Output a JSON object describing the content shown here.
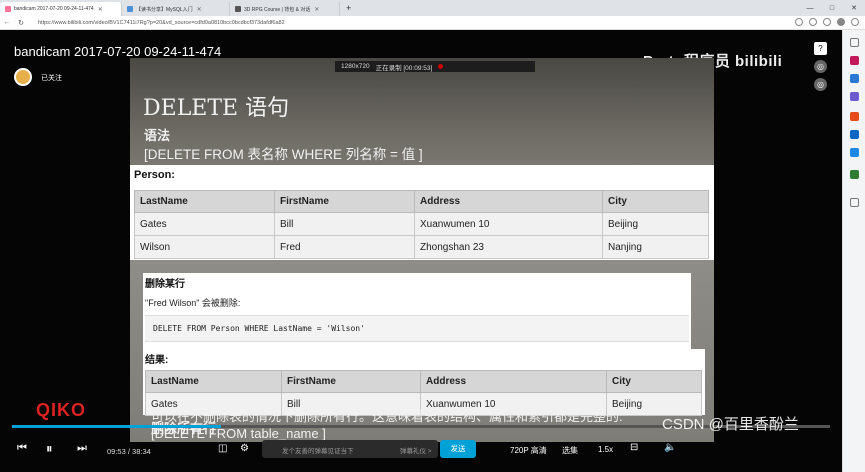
{
  "browser": {
    "tabs": [
      {
        "title": "bandicam 2017-07-20 09-24-11-474",
        "active": true,
        "color": "#fb7299"
      },
      {
        "title": "【读书分享】MySQL入门",
        "active": false,
        "color": "#4a90d9"
      },
      {
        "title": "3D RPG Course | 背包 & 对话",
        "active": false,
        "color": "#555555"
      }
    ],
    "new_tab": "+",
    "url": "https://www.bilibili.com/video/BV1C7411i7Rg?p=20&vd_source=cdfd0a0810bcc0bcdbcf373dafdf6a82",
    "window_controls": [
      "—",
      "□",
      "✕"
    ]
  },
  "video": {
    "title": "bandicam 2017-07-20 09-24-11-474",
    "follow_label": "已关注",
    "brand": "Prato程序员 bilibili",
    "side_controls": [
      "?",
      "◎",
      "◎"
    ],
    "recording_bar": {
      "resolution": "1280x720",
      "status": "正在录制 [00:09:53]"
    }
  },
  "slide": {
    "heading": "DELETE 语句",
    "syntax_label": "语法",
    "syntax": "[DELETE FROM 表名称 WHERE 列名称 = 值 ]",
    "person_label": "Person:",
    "person_table": {
      "headers": [
        "LastName",
        "FirstName",
        "Address",
        "City"
      ],
      "rows": [
        [
          "Gates",
          "Bill",
          "Xuanwumen 10",
          "Beijing"
        ],
        [
          "Wilson",
          "Fred",
          "Zhongshan 23",
          "Nanjing"
        ]
      ]
    },
    "delete_row_label": "删除某行",
    "delete_row_desc": "\"Fred Wilson\" 会被删除:",
    "delete_row_code": "DELETE FROM Person WHERE LastName = 'Wilson'",
    "result_label": "结果:",
    "result_table": {
      "headers": [
        "LastName",
        "FirstName",
        "Address",
        "City"
      ],
      "rows": [
        [
          "Gates",
          "Bill",
          "Xuanwumen 10",
          "Beijing"
        ]
      ]
    },
    "delete_all_label": "删除所有行",
    "delete_all_desc": "可以在不删除表的情况下删除所有行。这意味着表的结构、属性和索引都是完整的:",
    "delete_all_code": "[DELETE FROM table_name ]"
  },
  "player": {
    "current_time": "09:53",
    "total_time": "38:34",
    "progress": 0.256,
    "danmu_placeholder": "发个友善的弹幕见证当下",
    "danmu_etiquette": "弹幕礼仪 >",
    "send_label": "发送",
    "quality": "720P 高清",
    "episodes": "选集",
    "speed": "1.5x",
    "logo_left": "QIKO"
  },
  "watermark": "CSDN @百里香酚兰"
}
